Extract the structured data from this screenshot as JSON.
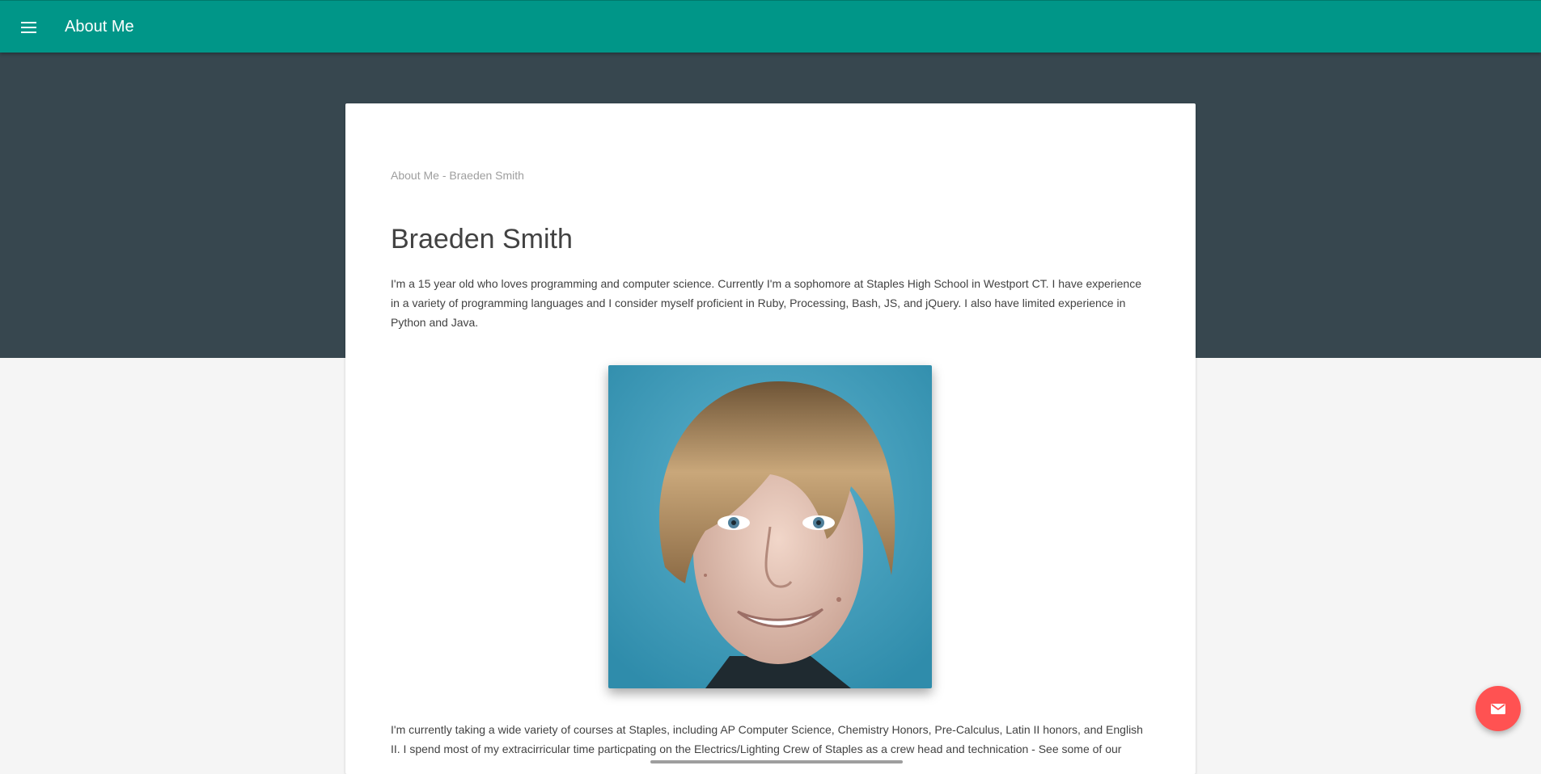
{
  "appbar": {
    "title": "About Me",
    "menu_icon": "hamburger-menu-icon",
    "color": "#009688"
  },
  "hero": {
    "color": "#37474f"
  },
  "card": {
    "breadcrumb": "About Me - Braeden Smith",
    "heading": "Braeden Smith",
    "intro": "I'm a 15 year old who loves programming and computer science. Currently I'm a sophomore at Staples High School in Westport CT. I have experience in a variety of programming languages and I consider myself proficient in Ruby, Processing, Bash, JS, and jQuery. I also have limited experience in Python and Java.",
    "photo_icon": "portrait-photo",
    "courses": "I'm currently taking a wide variety of courses at Staples, including AP Computer Science, Chemistry Honors, Pre-Calculus, Latin II honors, and English II. I spend most of my extracirricular time particpating on the Electrics/Lighting Crew of Staples as a crew head and technication - See some of our"
  },
  "fab": {
    "icon": "mail-icon",
    "color": "#ff5252"
  }
}
